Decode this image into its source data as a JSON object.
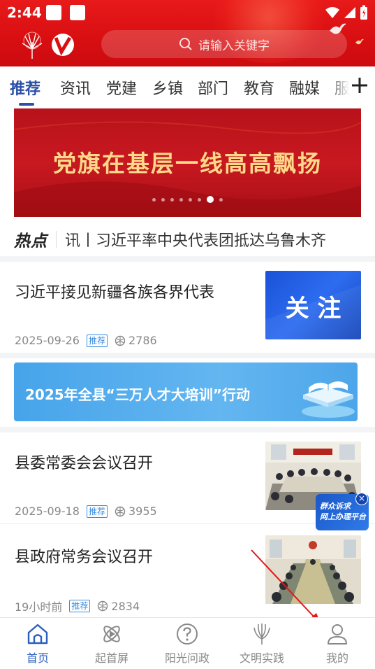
{
  "status_bar": {
    "time": "2:44"
  },
  "search": {
    "placeholder": "请输入关键字"
  },
  "tabs": [
    {
      "label": "推荐",
      "active": true
    },
    {
      "label": "资讯"
    },
    {
      "label": "党建"
    },
    {
      "label": "乡镇"
    },
    {
      "label": "部门"
    },
    {
      "label": "教育"
    },
    {
      "label": "融媒"
    },
    {
      "label": "服"
    }
  ],
  "banner": {
    "title": "党旗在基层一线高高飘扬",
    "slide_count": 8,
    "active_index": 6
  },
  "hot": {
    "label": "热点",
    "text": "讯丨习近平率中央代表团抵达乌鲁木齐"
  },
  "news": [
    {
      "title": "习近平接见新疆各族各界代表",
      "date": "2025-09-26",
      "tag": "推荐",
      "views": "2786",
      "thumb_text": "关 注"
    },
    {
      "title": "县委常委会会议召开",
      "date": "2025-09-18",
      "tag": "推荐",
      "views": "3955"
    },
    {
      "title": "县政府常务会议召开",
      "date": "19小时前",
      "tag": "推荐",
      "views": "2834"
    }
  ],
  "promo": {
    "text": "2025年全县“三万人才大培训”行动"
  },
  "float_ad": {
    "line1": "群众诉求",
    "line2": "网上办理平台",
    "close": "×"
  },
  "bottom_nav": [
    {
      "label": "首页",
      "icon": "home-icon",
      "active": true
    },
    {
      "label": "起首屏",
      "icon": "atom-icon"
    },
    {
      "label": "阳光问政",
      "icon": "question-icon"
    },
    {
      "label": "文明实践",
      "icon": "flower-icon"
    },
    {
      "label": "我的",
      "icon": "user-icon"
    }
  ],
  "colors": {
    "header_red": "#d90f12",
    "accent_blue": "#2a4fa6",
    "banner_gold": "#ffd989"
  }
}
